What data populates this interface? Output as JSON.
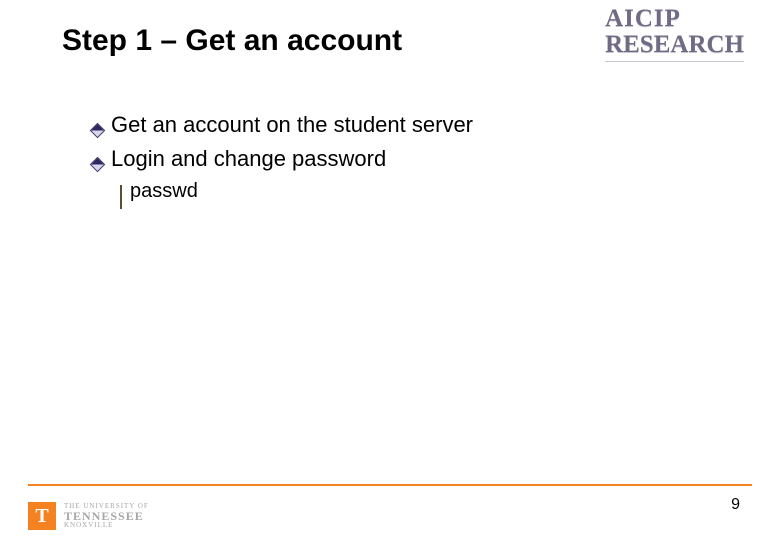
{
  "title": "Step 1 – Get an account",
  "logo_top": {
    "line1": "AICIP",
    "line2": "RESEARCH"
  },
  "bullets": [
    {
      "text": "Get an account on the student server"
    },
    {
      "text": "Login and change password"
    }
  ],
  "subbullets": [
    {
      "text": "passwd"
    }
  ],
  "footer": {
    "page_number": "9",
    "university": {
      "line1": "THE UNIVERSITY OF",
      "line2": "TENNESSEE",
      "line3": "KNOXVILLE"
    }
  }
}
